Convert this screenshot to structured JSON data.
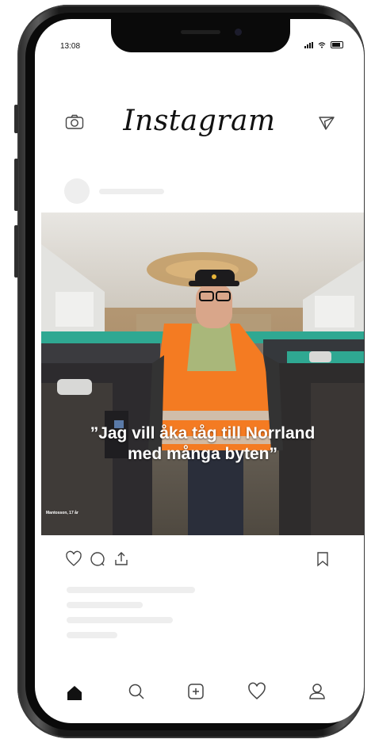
{
  "status_bar": {
    "time": "13:08"
  },
  "header": {
    "logo": "Instagram",
    "camera_icon": "camera-icon",
    "send_icon": "paper-plane-icon"
  },
  "post": {
    "caption_line1": "”Jag vill åka tåg till Norrland",
    "caption_line2": "med många byten”",
    "credit": "Mantosson, 17 år",
    "actions": {
      "like_icon": "heart-icon",
      "comment_icon": "comment-icon",
      "share_icon": "share-icon",
      "save_icon": "bookmark-icon"
    }
  },
  "tab_bar": {
    "items": [
      "home-icon",
      "search-icon",
      "add-icon",
      "heart-icon",
      "profile-icon"
    ],
    "active": "home-icon"
  },
  "colors": {
    "accent": "#ff7a1a",
    "vest": "#f47b22",
    "seat_teal": "#2fa892",
    "ink": "#111111",
    "placeholder": "#eeeeee"
  }
}
